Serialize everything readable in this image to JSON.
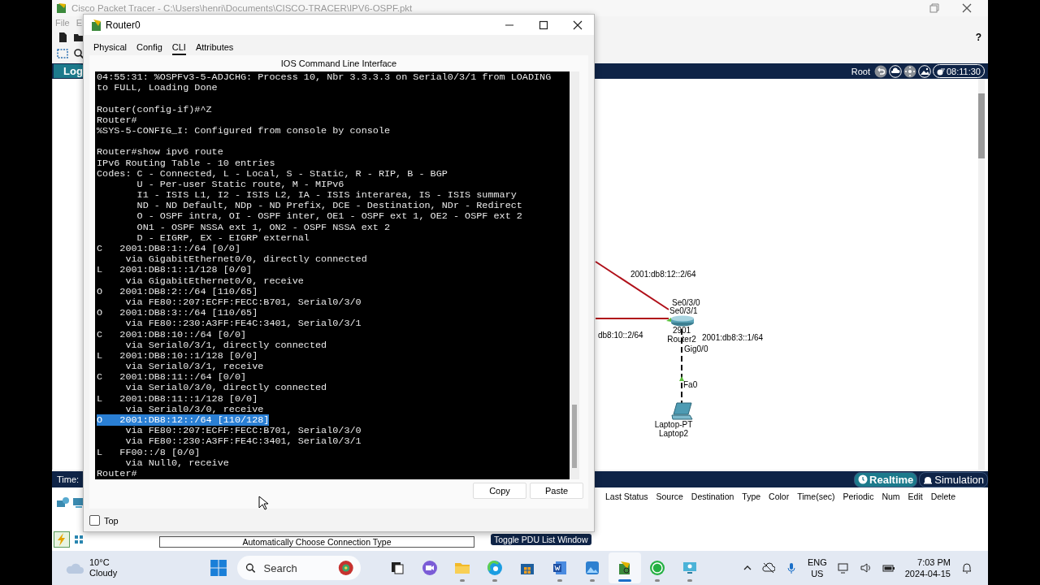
{
  "app_window": {
    "title": "Cisco Packet Tracer - C:\\Users\\henri\\Documents\\CISCO-TRACER\\IPV6-OSPF.pkt",
    "menu": [
      "File",
      "E"
    ],
    "help": "?",
    "logical_tab": "Log",
    "root_label": "Root",
    "clock": "08:11:30",
    "time_label": "Time:",
    "modes": [
      {
        "label": "Realtime",
        "selected": true
      },
      {
        "label": "Simulation",
        "selected": false
      }
    ],
    "pdu_columns": [
      "Last Status",
      "Source",
      "Destination",
      "Type",
      "Color",
      "Time(sec)",
      "Periodic",
      "Num",
      "Edit",
      "Delete"
    ],
    "connection_type": "Automatically Choose Connection Type",
    "toggle_pdu": "Toggle PDU List Window"
  },
  "topology": {
    "labels": [
      "2001:db8:12::2/64",
      "Se0/3/0",
      "Se0/3/1",
      "db8:10::2/64",
      "2001:db8:3::1/64",
      "Gig0/0",
      "Fa0"
    ],
    "router": {
      "model": "2901",
      "name": "Router2"
    },
    "laptop": {
      "model": "Laptop-PT",
      "name": "Laptop2"
    }
  },
  "dialog": {
    "title": "Router0",
    "tabs": [
      {
        "label": "Physical",
        "selected": false
      },
      {
        "label": "Config",
        "selected": false
      },
      {
        "label": "CLI",
        "selected": true
      },
      {
        "label": "Attributes",
        "selected": false
      }
    ],
    "heading": "IOS Command Line Interface",
    "terminal": {
      "blocks": [
        [
          {
            "text": "04:55:31: %OSPFv3-5-ADJCHG: Process 10, Nbr 3.3.3.3 on Serial0/3/1 from LOADING",
            "selected": false
          },
          {
            "text": "to FULL, Loading Done",
            "selected": false
          }
        ],
        [
          {
            "text": "Router(config-if)#^Z",
            "selected": false
          },
          {
            "text": "Router#",
            "selected": false
          },
          {
            "text": "%SYS-5-CONFIG_I: Configured from console by console",
            "selected": false
          }
        ],
        [
          {
            "text": "Router#show ipv6 route",
            "selected": false
          },
          {
            "text": "IPv6 Routing Table - 10 entries",
            "selected": false
          },
          {
            "text": "Codes: C - Connected, L - Local, S - Static, R - RIP, B - BGP",
            "selected": false
          },
          {
            "text": "       U - Per-user Static route, M - MIPv6",
            "selected": false
          },
          {
            "text": "       I1 - ISIS L1, I2 - ISIS L2, IA - ISIS interarea, IS - ISIS summary",
            "selected": false
          },
          {
            "text": "       ND - ND Default, NDp - ND Prefix, DCE - Destination, NDr - Redirect",
            "selected": false
          },
          {
            "text": "       O - OSPF intra, OI - OSPF inter, OE1 - OSPF ext 1, OE2 - OSPF ext 2",
            "selected": false
          },
          {
            "text": "       ON1 - OSPF NSSA ext 1, ON2 - OSPF NSSA ext 2",
            "selected": false
          },
          {
            "text": "       D - EIGRP, EX - EIGRP external",
            "selected": false
          },
          {
            "text": "C   2001:DB8:1::/64 [0/0]",
            "selected": false
          },
          {
            "text": "     via GigabitEthernet0/0, directly connected",
            "selected": false
          },
          {
            "text": "L   2001:DB8:1::1/128 [0/0]",
            "selected": false
          },
          {
            "text": "     via GigabitEthernet0/0, receive",
            "selected": false
          },
          {
            "text": "O   2001:DB8:2::/64 [110/65]",
            "selected": false
          },
          {
            "text": "     via FE80::207:ECFF:FECC:B701, Serial0/3/0",
            "selected": false
          },
          {
            "text": "O   2001:DB8:3::/64 [110/65]",
            "selected": false
          },
          {
            "text": "     via FE80::230:A3FF:FE4C:3401, Serial0/3/1",
            "selected": false
          },
          {
            "text": "C   2001:DB8:10::/64 [0/0]",
            "selected": false
          },
          {
            "text": "     via Serial0/3/1, directly connected",
            "selected": false
          },
          {
            "text": "L   2001:DB8:10::1/128 [0/0]",
            "selected": false
          },
          {
            "text": "     via Serial0/3/1, receive",
            "selected": false
          },
          {
            "text": "C   2001:DB8:11::/64 [0/0]",
            "selected": false
          },
          {
            "text": "     via Serial0/3/0, directly connected",
            "selected": false
          },
          {
            "text": "L   2001:DB8:11::1/128 [0/0]",
            "selected": false
          },
          {
            "text": "     via Serial0/3/0, receive",
            "selected": false
          },
          {
            "text": "O   2001:DB8:12::/64 [110/128]",
            "selected": true
          },
          {
            "text": "     via FE80::207:ECFF:FECC:B701, Serial0/3/0",
            "selected": false
          },
          {
            "text": "     via FE80::230:A3FF:FE4C:3401, Serial0/3/1",
            "selected": false
          },
          {
            "text": "L   FF00::/8 [0/0]",
            "selected": false
          },
          {
            "text": "     via Null0, receive",
            "selected": false
          },
          {
            "text": "Router#",
            "selected": false
          }
        ]
      ]
    },
    "buttons": [
      "Copy",
      "Paste"
    ],
    "top_checkbox": {
      "label": "Top",
      "checked": false
    }
  },
  "taskbar": {
    "weather": {
      "temp": "10°C",
      "condition": "Cloudy"
    },
    "search": {
      "placeholder": "Search"
    },
    "apps": [
      {
        "kind": "taskview",
        "running": false,
        "active": false
      },
      {
        "kind": "chat",
        "running": false,
        "active": false
      },
      {
        "kind": "files",
        "running": true,
        "active": false
      },
      {
        "kind": "edge",
        "running": true,
        "active": false
      },
      {
        "kind": "store",
        "running": false,
        "active": false
      },
      {
        "kind": "word",
        "running": true,
        "active": false
      },
      {
        "kind": "photos",
        "running": true,
        "active": false
      },
      {
        "kind": "tracer",
        "running": true,
        "active": true
      },
      {
        "kind": "whatsapp",
        "running": true,
        "active": false
      },
      {
        "kind": "remote",
        "running": true,
        "active": false
      }
    ],
    "language": "ENG",
    "region": "US",
    "time": "7:03 PM",
    "date": "2024-04-15"
  }
}
